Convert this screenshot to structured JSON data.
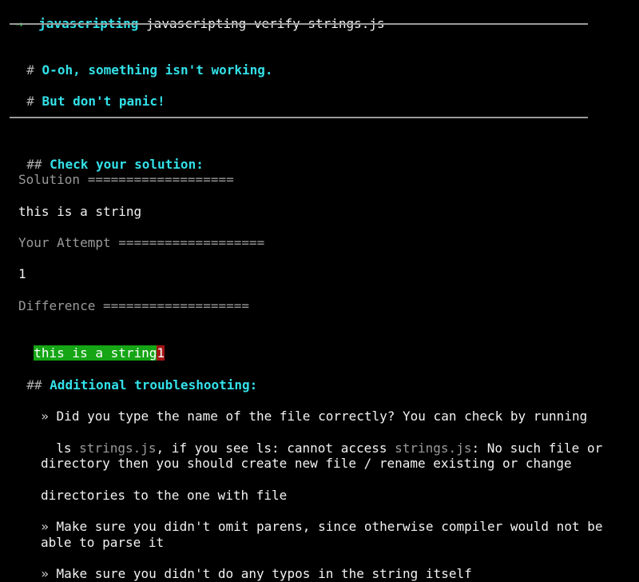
{
  "prompt": {
    "arrow": "→",
    "dir": "javascripting",
    "command": "javascripting verify strings.js"
  },
  "header": {
    "hash": "#",
    "line1": "O-oh, something isn't working.",
    "line2": "But don't panic!"
  },
  "check": {
    "hash": "##",
    "title": "Check your solution:",
    "solution_label": "Solution ===================",
    "solution_value": "this is a string",
    "attempt_label": "Your Attempt ===================",
    "attempt_value": "1",
    "difference_label": "Difference ===================",
    "diff_same": "this is a string",
    "diff_added": "1"
  },
  "troubleshooting": {
    "hash": "##",
    "title": "Additional troubleshooting:",
    "bullet": "»",
    "item1_l1": "Did you type the name of the file correctly? You can check by running",
    "item1_l2_a": "ls ",
    "item1_l2_b": "strings.js",
    "item1_l2_c": ", if you see ls: cannot access ",
    "item1_l2_d": "strings.js",
    "item1_l2_e": ": No such file or",
    "item1_l3": "directory then you should create new file / rename existing or change",
    "item1_l4": "directories to the one with file",
    "item2_l1": "Make sure you didn't omit parens, since otherwise compiler would not be",
    "item2_l2": "able to parse it",
    "item3_l1": "Make sure you didn't do any typos in the string itself"
  }
}
